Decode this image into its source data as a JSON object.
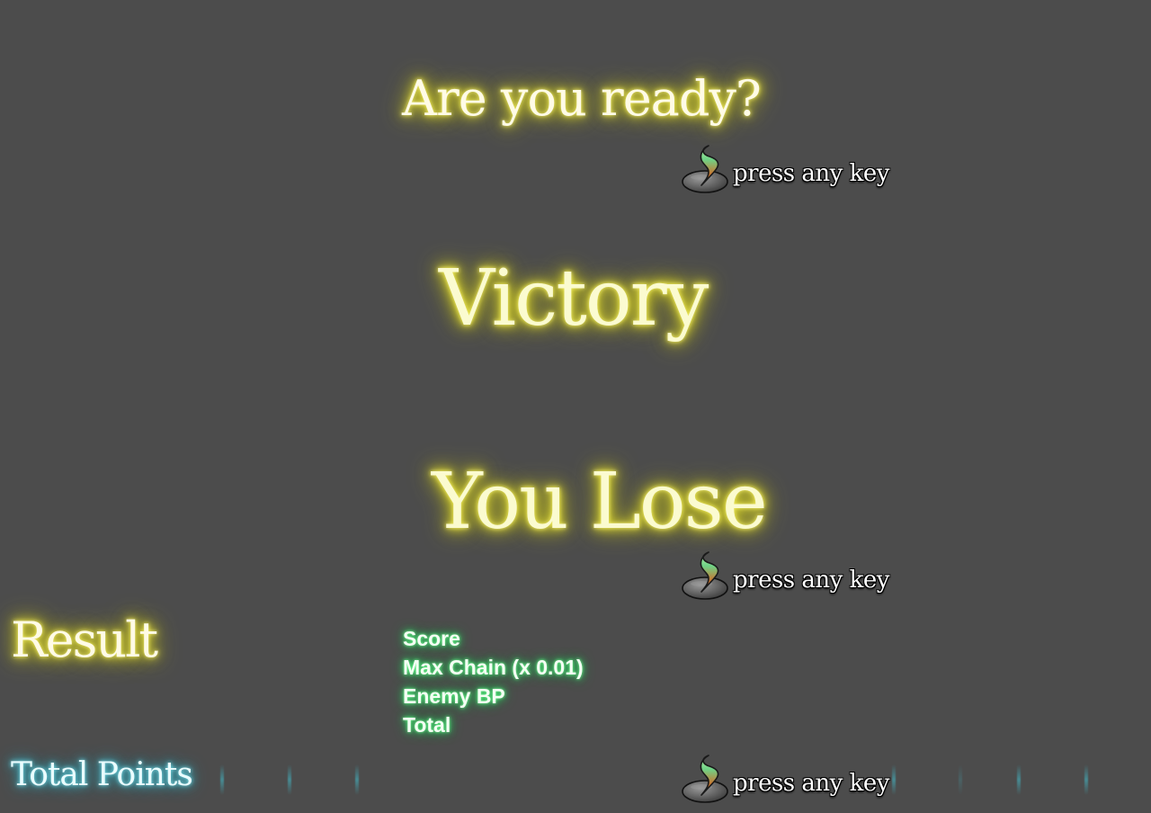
{
  "screens": {
    "ready_title": "Are you ready?",
    "victory_title": "Victory",
    "lose_title": "You Lose",
    "result_title": "Result",
    "total_points_title": "Total Points"
  },
  "prompts": {
    "press_any_key": "press any key",
    "icon": "flame-orb-icon"
  },
  "result_rows": [
    "Score",
    "Max Chain  (x 0.01)",
    "Enemy BP",
    "Total"
  ],
  "colors": {
    "background": "#4c4c4c",
    "yellow_glow": "#e8e23a",
    "green_glow": "#2ee86a",
    "cyan_glow": "#3cc8dc"
  }
}
